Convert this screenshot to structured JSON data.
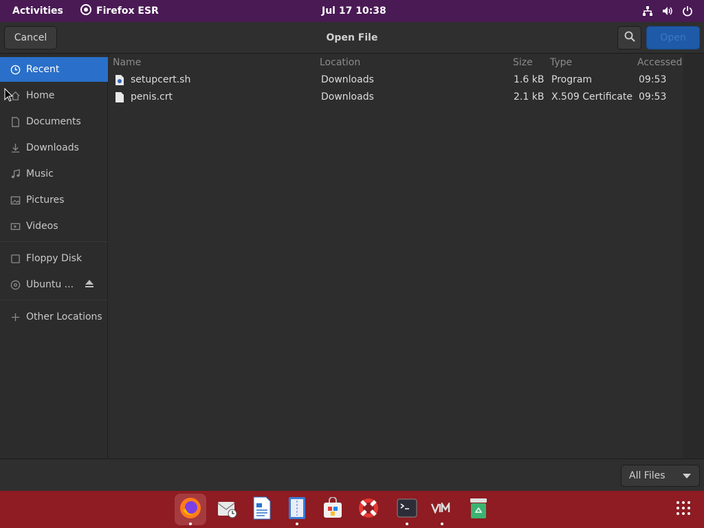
{
  "topbar": {
    "activities": "Activities",
    "app_name": "Firefox ESR",
    "clock": "Jul 17  10:38",
    "tray_icons": [
      "network-icon",
      "volume-icon",
      "power-icon"
    ]
  },
  "dialog": {
    "title": "Open File",
    "cancel_label": "Cancel",
    "open_label": "Open"
  },
  "sidebar": {
    "items": [
      {
        "label": "Recent",
        "icon": "clock-icon",
        "active": true
      },
      {
        "label": "Home",
        "icon": "home-icon"
      },
      {
        "label": "Documents",
        "icon": "document-icon"
      },
      {
        "label": "Downloads",
        "icon": "download-icon"
      },
      {
        "label": "Music",
        "icon": "music-icon"
      },
      {
        "label": "Pictures",
        "icon": "picture-icon"
      },
      {
        "label": "Videos",
        "icon": "video-icon"
      },
      {
        "label": "Floppy Disk",
        "icon": "floppy-icon"
      },
      {
        "label": "Ubuntu ...",
        "icon": "disc-icon"
      },
      {
        "label": "Other Locations",
        "icon": "plus-icon"
      }
    ]
  },
  "file_list": {
    "columns": [
      "Name",
      "Location",
      "Size",
      "Type",
      "Accessed"
    ],
    "rows": [
      {
        "name": "setupcert.sh",
        "location": "Downloads",
        "size": "1.6 kB",
        "type": "Program",
        "accessed": "09:53",
        "icon": "script-file-icon"
      },
      {
        "name": "penis.crt",
        "location": "Downloads",
        "size": "2.1 kB",
        "type": "X.509 Certificate",
        "accessed": "09:53",
        "icon": "text-file-icon"
      }
    ]
  },
  "filter": {
    "selected": "All Files"
  },
  "dock": {
    "items": [
      "firefox-icon",
      "evolution-icon",
      "writer-icon",
      "text-editor-icon",
      "software-center-icon",
      "help-icon",
      "terminal-icon",
      "vim-icon",
      "trash-icon"
    ],
    "apps_grid": "show-apps-icon"
  },
  "colors": {
    "topbar": "#4a1a55",
    "accent": "#2a6fc9",
    "dock": "#8e1c22"
  }
}
